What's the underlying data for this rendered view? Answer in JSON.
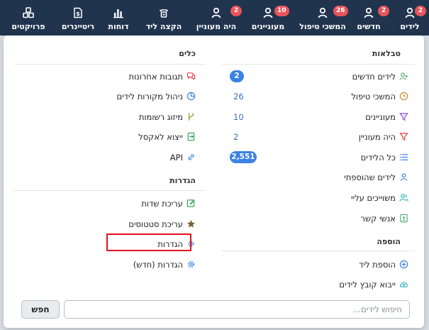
{
  "nav": {
    "items": [
      {
        "label": "לידים",
        "badge": "2"
      },
      {
        "label": "חדשים",
        "badge": "2"
      },
      {
        "label": "המשכי טיפול",
        "badge": "26"
      },
      {
        "label": "מעוניינים",
        "badge": "10"
      },
      {
        "label": "היה מעוניין",
        "badge": "2"
      },
      {
        "label": "הקצה ליד",
        "badge": ""
      },
      {
        "label": "דוחות",
        "badge": ""
      },
      {
        "label": "ריטיינרים",
        "badge": ""
      },
      {
        "label": "פרויקטים",
        "badge": ""
      }
    ]
  },
  "tables": {
    "title": "טבלאות",
    "items": [
      {
        "label": "לידים חדשים",
        "count": "2",
        "icon": "user-plus-icon"
      },
      {
        "label": "המשכי טיפול",
        "count": "26",
        "icon": "clock-icon"
      },
      {
        "label": "מעוניינים",
        "count": "10",
        "icon": "filter-icon"
      },
      {
        "label": "היה מעוניין",
        "count": "2",
        "icon": "filter-icon"
      },
      {
        "label": "כל הלידים",
        "count": "2,551",
        "icon": "list-icon"
      },
      {
        "label": "לידים שהוספתי",
        "count": "",
        "icon": "user-icon"
      },
      {
        "label": "משוייכים עליי",
        "count": "",
        "icon": "users-icon"
      },
      {
        "label": "אנשי קשר",
        "count": "",
        "icon": "contact-card-icon"
      }
    ]
  },
  "add": {
    "title": "הוספה",
    "items": [
      {
        "label": "הוספת ליד",
        "icon": "plus-circle-icon"
      },
      {
        "label": "ייבוא קובץ לידים",
        "icon": "cloud-upload-icon"
      }
    ]
  },
  "tools": {
    "title": "כלים",
    "items": [
      {
        "label": "תגובות אחרונות",
        "icon": "comments-icon"
      },
      {
        "label": "ניהול מקורות לידים",
        "icon": "pie-chart-icon"
      },
      {
        "label": "מיזוג רשומות",
        "icon": "merge-icon"
      },
      {
        "label": "ייצוא לאקסל",
        "icon": "excel-export-icon"
      },
      {
        "label": "API",
        "icon": "link-icon"
      }
    ]
  },
  "settings": {
    "title": "הגדרות",
    "items": [
      {
        "label": "עריכת שדות",
        "icon": "edit-icon"
      },
      {
        "label": "עריכת סטטוסים",
        "icon": "star-icon"
      },
      {
        "label": "הגדרות",
        "icon": "gear-icon"
      },
      {
        "label": "הגדרות (חדש)",
        "icon": "gear-icon"
      }
    ]
  },
  "search": {
    "placeholder": "חיפוש לידים...",
    "button": "חפש"
  },
  "colors": {
    "topbar": "#20344e",
    "badge": "#e8545a",
    "pill": "#3b82e6",
    "highlight": "#e0121c"
  }
}
